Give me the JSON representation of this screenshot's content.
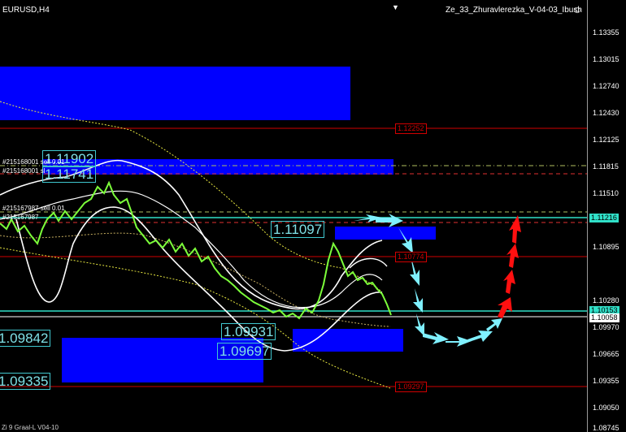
{
  "header": {
    "symbol": "EURUSD,H4",
    "indicator": "Ze_33_Zhuravlerezka_V-04-03_Ibush",
    "smiley": "☺"
  },
  "footer": "Zi 9 Graal-L V04-10",
  "price_axis": {
    "ticks": [
      "1.13355",
      "1.13015",
      "1.12740",
      "1.12430",
      "1.12125",
      "1.11815",
      "1.11510",
      "1.11216",
      "1.10895",
      "1.10280",
      "1.10053",
      "1.09970",
      "1.09665",
      "1.09355",
      "1.09050",
      "1.08745"
    ],
    "current_price": "1.11216",
    "bid_price": "1.10153",
    "bid2": "1.10058"
  },
  "levels": {
    "l1": "1.12252",
    "l2": "1.10774",
    "l3": "1.09297"
  },
  "boxes": {
    "b1": "1.11902",
    "b2": "1.11741",
    "b3": "1.11097",
    "b4": "1.09931",
    "b5": "1.09697",
    "b6": "1.09842",
    "b7": "1.09335"
  },
  "comments": {
    "c1": "#215168001 sell 0.01",
    "c2": "#215168001 sl",
    "c3": "#215167987 sell 0.01",
    "c4": "#215167987"
  },
  "colors": {
    "zone": "#0000ff",
    "forecast_down": "#7ff0ff",
    "forecast_up": "#ff1010",
    "candle": "#7cff3a",
    "envelope": "#ffffff",
    "level_line": "#d00000",
    "bid_line": "#30e0c8"
  }
}
